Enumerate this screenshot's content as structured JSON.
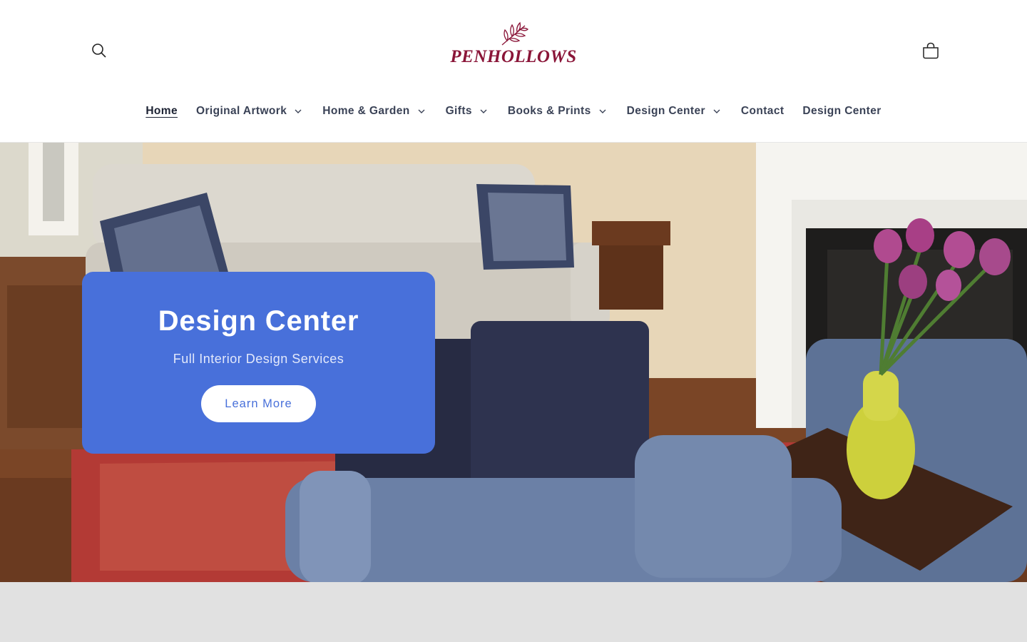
{
  "header": {
    "logo": {
      "text": "PENHOLLOWS",
      "color": "#8a1538"
    },
    "search_icon": "search-icon",
    "cart_icon": "cart-icon"
  },
  "nav": {
    "items": [
      {
        "label": "Home",
        "active": true,
        "has_dropdown": false
      },
      {
        "label": "Original Artwork",
        "active": false,
        "has_dropdown": true
      },
      {
        "label": "Home & Garden",
        "active": false,
        "has_dropdown": true
      },
      {
        "label": "Gifts",
        "active": false,
        "has_dropdown": true
      },
      {
        "label": "Books & Prints",
        "active": false,
        "has_dropdown": true
      },
      {
        "label": "Design Center",
        "active": false,
        "has_dropdown": true
      },
      {
        "label": "Contact",
        "active": false,
        "has_dropdown": false
      },
      {
        "label": "Design Center",
        "active": false,
        "has_dropdown": false
      }
    ]
  },
  "hero": {
    "title": "Design Center",
    "subtitle": "Full Interior Design Services",
    "button_label": "Learn More",
    "panel_color": "#4870da"
  }
}
